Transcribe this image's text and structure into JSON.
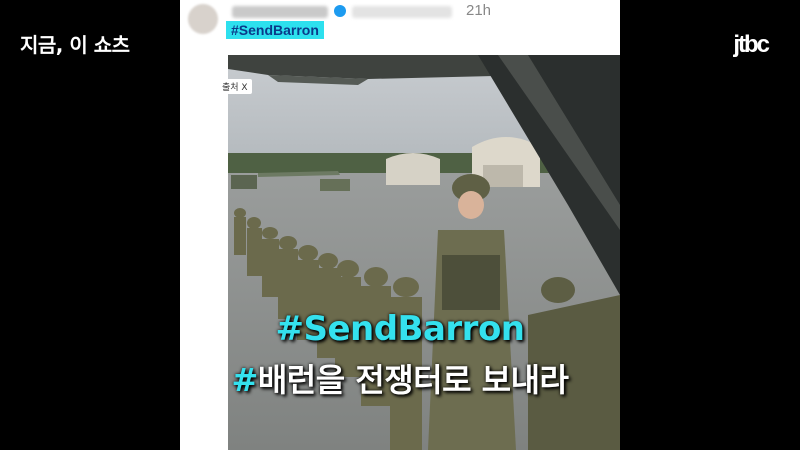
{
  "header": {
    "show_title": "지금, 이 쇼츠",
    "brand": "jtbc"
  },
  "post": {
    "timestamp": "21h",
    "hashtag": "#SendBarron",
    "photo_source_label": "출처 X"
  },
  "captions": {
    "line1_tag": "#SendBarron",
    "line2_hash": "#",
    "line2_text": "배런을 전쟁터로 보내라"
  },
  "colors": {
    "caption_accent": "#34e1ee",
    "hashtag_highlight": "#2de0ee",
    "verified_badge": "#1d9bf0"
  }
}
